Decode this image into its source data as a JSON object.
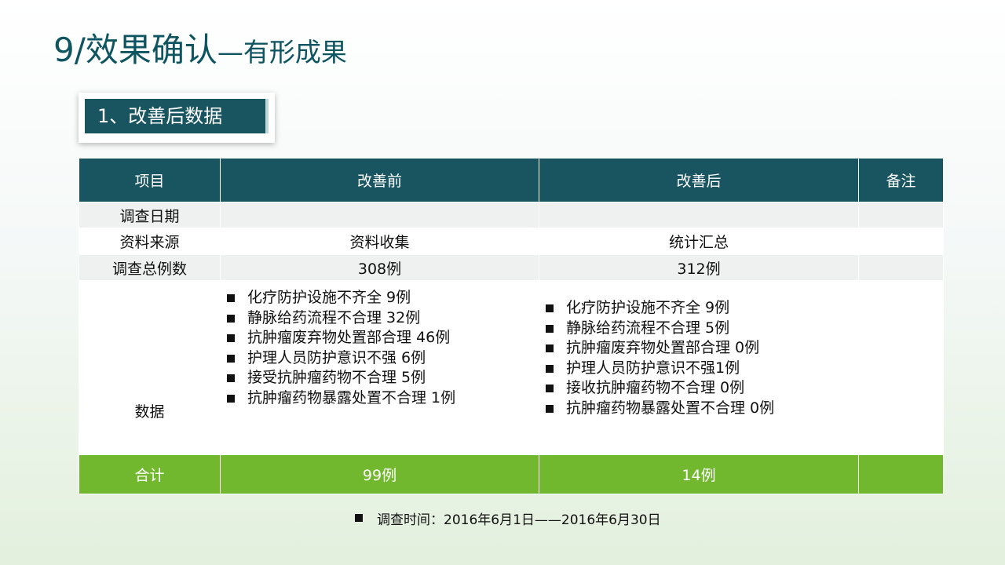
{
  "title": {
    "main": "9/效果确认",
    "sub": "—有形成果"
  },
  "section_label": "1、改善后数据",
  "table": {
    "headers": [
      "项目",
      "改善前",
      "改善后",
      "备注"
    ],
    "rows": [
      {
        "item": "调查日期",
        "before": "",
        "after": "",
        "note": ""
      },
      {
        "item": "资料来源",
        "before": "资料收集",
        "after": "统计汇总",
        "note": ""
      },
      {
        "item": "调查总例数",
        "before": "308例",
        "after": "312例",
        "note": ""
      }
    ],
    "data_row": {
      "item": "数据",
      "before": [
        "化疗防护设施不齐全 9例",
        "静脉给药流程不合理 32例",
        "抗肿瘤废弃物处置部合理 46例",
        "护理人员防护意识不强 6例",
        "接受抗肿瘤药物不合理 5例",
        "抗肿瘤药物暴露处置不合理 1例"
      ],
      "after": [
        "化疗防护设施不齐全 9例",
        "静脉给药流程不合理 5例",
        "抗肿瘤废弃物处置部合理 0例",
        "护理人员防护意识不强1例",
        "接收抗肿瘤药物不合理 0例",
        "抗肿瘤药物暴露处置不合理 0例"
      ],
      "note": ""
    },
    "total_row": {
      "item": "合计",
      "before": "99例",
      "after": "14例",
      "note": ""
    }
  },
  "footnote": "调查时间：2016年6月1日——2016年6月30日"
}
